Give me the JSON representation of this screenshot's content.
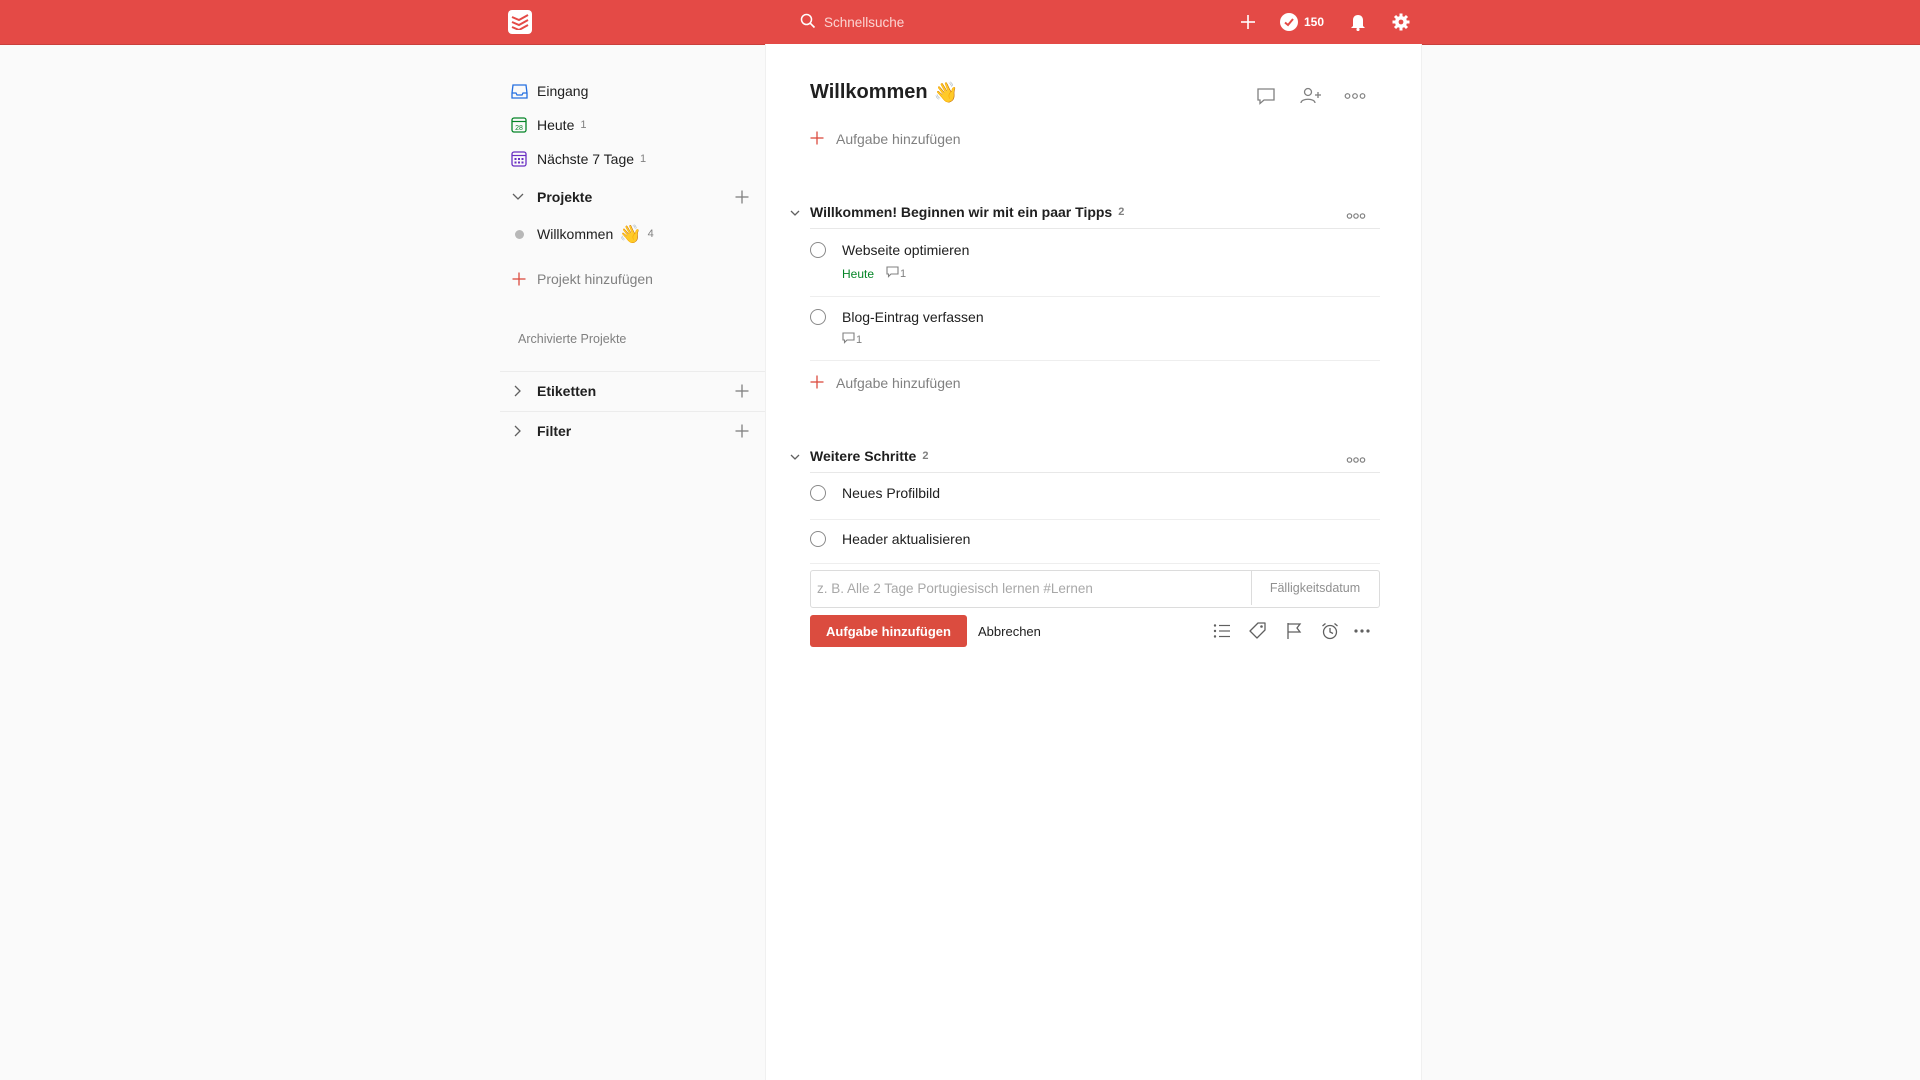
{
  "colors": {
    "accent": "#e44a46",
    "due_today": "#058527",
    "primary_button": "#db4c3f"
  },
  "topbar": {
    "search_placeholder": "Schnellsuche",
    "karma_count": "150",
    "icons": [
      "todoist-logo-icon",
      "search-icon",
      "plus-icon",
      "check-circle-icon",
      "bell-icon",
      "gear-icon"
    ]
  },
  "sidebar": {
    "nav": [
      {
        "label": "Eingang",
        "count": "",
        "icon": "inbox-icon"
      },
      {
        "label": "Heute",
        "count": "1",
        "icon": "calendar-today-icon",
        "day": "28"
      },
      {
        "label": "Nächste 7 Tage",
        "count": "1",
        "icon": "calendar-week-icon"
      }
    ],
    "projects_label": "Projekte",
    "projects": [
      {
        "label": "Willkommen",
        "emoji": "👋",
        "count": "4"
      }
    ],
    "add_project": "Projekt hinzufügen",
    "archived": "Archivierte Projekte",
    "labels_label": "Etiketten",
    "filters_label": "Filter"
  },
  "main": {
    "title": "Willkommen",
    "title_emoji": "👋",
    "add_task": "Aufgabe hinzufügen",
    "sections": [
      {
        "title": "Willkommen! Beginnen wir mit ein paar Tipps",
        "count": "2",
        "tasks": [
          {
            "name": "Webseite optimieren",
            "due": "Heute",
            "comments": "1"
          },
          {
            "name": "Blog-Eintrag verfassen",
            "due": "",
            "comments": "1"
          }
        ]
      },
      {
        "title": "Weitere Schritte",
        "count": "2",
        "tasks": [
          {
            "name": "Neues Profilbild"
          },
          {
            "name": "Header aktualisieren"
          }
        ]
      }
    ],
    "editor": {
      "placeholder": "z. B. Alle 2 Tage Portugiesisch lernen #Lernen",
      "due_placeholder": "Fälligkeitsdatum",
      "submit": "Aufgabe hinzufügen",
      "cancel": "Abbrechen"
    }
  }
}
